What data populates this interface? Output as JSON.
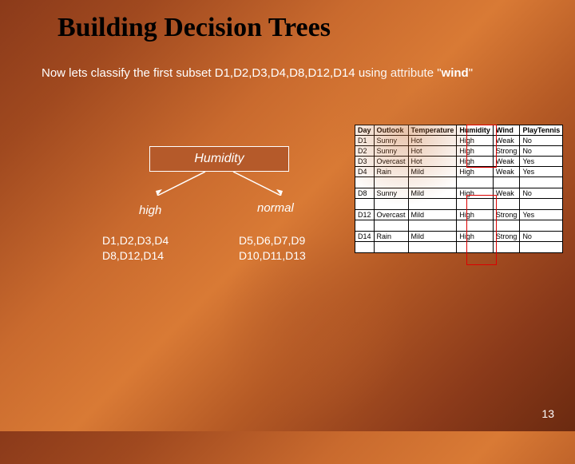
{
  "title": "Building Decision Trees",
  "body": {
    "prefix": "Now  lets classify the first subset D1,D2,D3,D4,D8,D12,D14 using attribute ",
    "attr_quote_open": "\"",
    "attr": "wind",
    "attr_quote_close": "\""
  },
  "tree": {
    "root": "Humidity",
    "left_label": "high",
    "right_label": "normal",
    "left_leaf_l1": "D1,D2,D3,D4",
    "left_leaf_l2": "D8,D12,D14",
    "right_leaf_l1": "D5,D6,D7,D9",
    "right_leaf_l2": "D10,D11,D13"
  },
  "table": {
    "headers": [
      "Day",
      "Outlook",
      "Temperature",
      "Humidity",
      "Wind",
      "PlayTennis"
    ],
    "group1": [
      [
        "D1",
        "Sunny",
        "Hot",
        "High",
        "Weak",
        "No"
      ],
      [
        "D2",
        "Sunny",
        "Hot",
        "High",
        "Strong",
        "No"
      ],
      [
        "D3",
        "Overcast",
        "Hot",
        "High",
        "Weak",
        "Yes"
      ],
      [
        "D4",
        "Rain",
        "Mild",
        "High",
        "Weak",
        "Yes"
      ]
    ],
    "group2": [
      [
        "D8",
        "Sunny",
        "Mild",
        "High",
        "Weak",
        "No"
      ]
    ],
    "group3": [
      [
        "D12",
        "Overcast",
        "Mild",
        "High",
        "Strong",
        "Yes"
      ]
    ],
    "group4": [
      [
        "D14",
        "Rain",
        "Mild",
        "High",
        "Strong",
        "No"
      ]
    ]
  },
  "page_number": "13"
}
